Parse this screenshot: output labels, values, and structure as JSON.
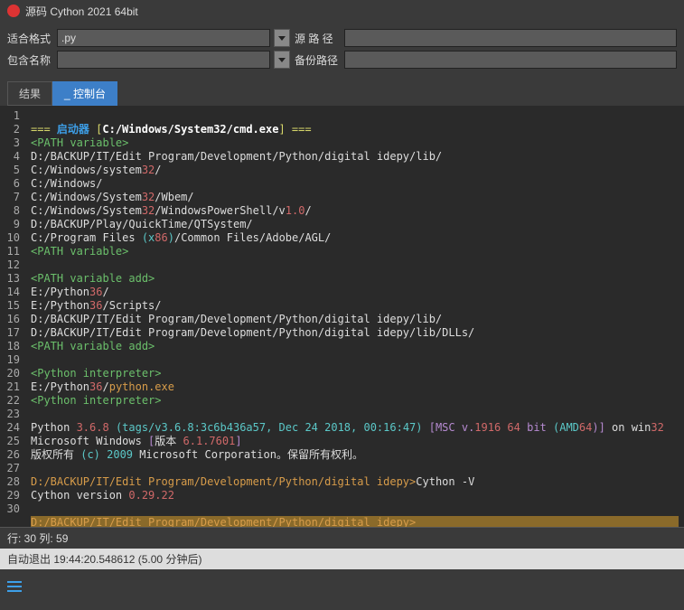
{
  "title": "源码 Cython 2021 64bit",
  "toolbar": {
    "row1_label": "适合格式",
    "ext_value": ".py",
    "row1_label2": "源 路 径",
    "src_path": "",
    "row2_label": "包含名称",
    "name_value": "",
    "row2_label2": "备份路径",
    "backup_path": ""
  },
  "tabs": {
    "result": "结果",
    "console_us": "_",
    "console": " 控制台"
  },
  "code": {
    "l1a": "=== ",
    "l1b": "启动器 ",
    "l1c": "[",
    "l1d": "C:/Windows/System32/cmd.exe",
    "l1e": "] ===",
    "l2": "<PATH variable>",
    "l3": "D:/BACKUP/IT/Edit Program/Development/Python/digital idepy/lib/",
    "l4a": "C:/Windows/system",
    "l4b": "32",
    "l4c": "/",
    "l5": "C:/Windows/",
    "l6a": "C:/Windows/System",
    "l6b": "32",
    "l6c": "/Wbem/",
    "l7a": "C:/Windows/System",
    "l7b": "32",
    "l7c": "/WindowsPowerShell/v",
    "l7d": "1.0",
    "l7e": "/",
    "l8": "D:/BACKUP/Play/QuickTime/QTSystem/",
    "l9a": "C:/Program Files ",
    "l9b": "(x",
    "l9c": "86",
    "l9d": ")",
    "l9e": "/Common Files/Adobe/AGL/",
    "l10": "<PATH variable>",
    "l12": "<PATH variable add>",
    "l13a": "E:/Python",
    "l13b": "36",
    "l13c": "/",
    "l14a": "E:/Python",
    "l14b": "36",
    "l14c": "/Scripts/",
    "l15": "D:/BACKUP/IT/Edit Program/Development/Python/digital idepy/lib/",
    "l16": "D:/BACKUP/IT/Edit Program/Development/Python/digital idepy/lib/DLLs/",
    "l17": "<PATH variable add>",
    "l19": "<Python interpreter>",
    "l20a": "E:/Python",
    "l20b": "36",
    "l20c": "/",
    "l20d": "python.exe",
    "l21": "<Python interpreter>",
    "l23a": "Python ",
    "l23b": "3.6.8 ",
    "l23c": "(tags/v3.6.8:3c6b436a57, Dec 24 2018, 00:16:47) ",
    "l23d": "[MSC v.",
    "l23e": "1916 64",
    "l23f": " bit ",
    "l23g": "(AMD",
    "l23h": "64",
    "l23i": ")]",
    "l23j": " on win",
    "l23k": "32",
    "l24a": "Microsoft Windows ",
    "l24b": "[",
    "l24c": "版本 ",
    "l24d": "6.1.7601",
    "l24e": "]",
    "l25a": "版权所有 ",
    "l25b": "(c) 2009",
    "l25c": " Microsoft Corporation。保留所有权利。",
    "l27a": "D:/BACKUP/IT/Edit Program/Development/Python/digital idepy>",
    "l27b": "Cython -V",
    "l28a": "Cython version ",
    "l28b": "0.29.22",
    "l30": "D:/BACKUP/IT/Edit Program/Development/Python/digital idepy>"
  },
  "status": {
    "line_label": "行: ",
    "line": "30",
    "col_label": "  列: ",
    "col": "59"
  },
  "footer": {
    "text": "自动退出 19:44:20.548612 (5.00 分钟后)"
  }
}
